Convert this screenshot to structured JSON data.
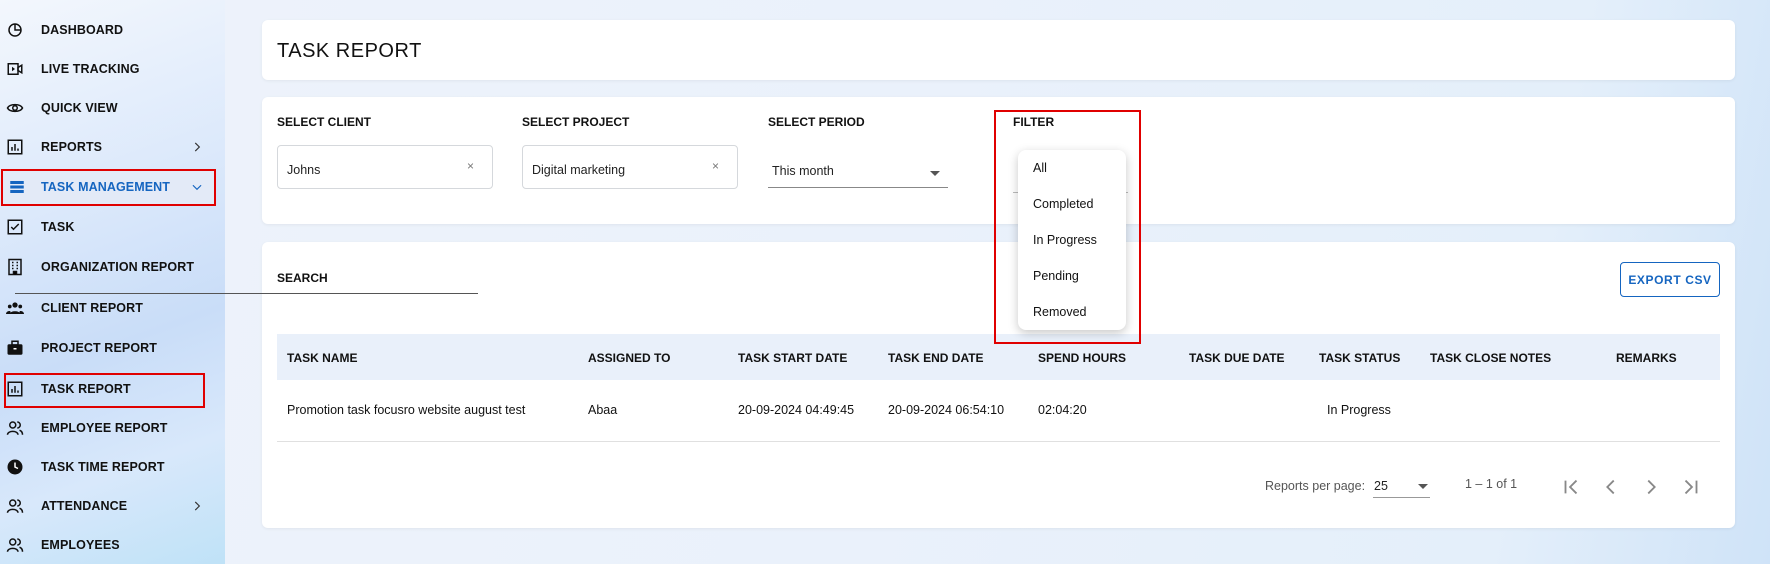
{
  "sidebar": {
    "items": [
      {
        "label": "DASHBOARD",
        "icon": "dashboard-icon"
      },
      {
        "label": "LIVE TRACKING",
        "icon": "video-icon"
      },
      {
        "label": "QUICK VIEW",
        "icon": "eye-icon"
      },
      {
        "label": "REPORTS",
        "icon": "report-icon"
      },
      {
        "label": "TASK MANAGEMENT",
        "icon": "task-management-icon"
      },
      {
        "label": "TASK",
        "icon": "checkbox-icon"
      },
      {
        "label": "ORGANIZATION REPORT",
        "icon": "building-icon"
      },
      {
        "label": "CLIENT REPORT",
        "icon": "group-icon"
      },
      {
        "label": "PROJECT REPORT",
        "icon": "briefcase-icon"
      },
      {
        "label": "TASK REPORT",
        "icon": "report-icon"
      },
      {
        "label": "EMPLOYEE REPORT",
        "icon": "people-icon"
      },
      {
        "label": "TASK TIME REPORT",
        "icon": "clock-icon"
      },
      {
        "label": "ATTENDANCE",
        "icon": "people-icon"
      },
      {
        "label": "EMPLOYEES",
        "icon": "people-icon"
      }
    ]
  },
  "header": {
    "title": "TASK REPORT"
  },
  "filters": {
    "client": {
      "label": "SELECT CLIENT",
      "value": "Johns",
      "clear": "×"
    },
    "project": {
      "label": "SELECT PROJECT",
      "value": "Digital marketing",
      "clear": "×"
    },
    "period": {
      "label": "SELECT PERIOD",
      "value": "This month"
    },
    "filter": {
      "label": "FILTER",
      "options": [
        "All",
        "Completed",
        "In Progress",
        "Pending",
        "Removed"
      ]
    }
  },
  "search": {
    "label": "SEARCH"
  },
  "export": {
    "label": "EXPORT CSV"
  },
  "table": {
    "columns": [
      "TASK NAME",
      "ASSIGNED TO",
      "TASK START DATE",
      "TASK END DATE",
      "SPEND HOURS",
      "TASK DUE DATE",
      "TASK STATUS",
      "TASK CLOSE NOTES",
      "REMARKS"
    ],
    "rows": [
      {
        "task_name": "Promotion task focusro website august test",
        "assigned_to": "Abaa",
        "start": "20-09-2024 04:49:45",
        "end": "20-09-2024 06:54:10",
        "spend": "02:04:20",
        "due": "",
        "status": "In Progress",
        "notes": "",
        "remarks": ""
      }
    ]
  },
  "pager": {
    "per_page_label": "Reports per page:",
    "per_page": "25",
    "range": "1 – 1 of 1"
  },
  "colors": {
    "accent": "#1565c0",
    "highlight": "#e00000"
  }
}
